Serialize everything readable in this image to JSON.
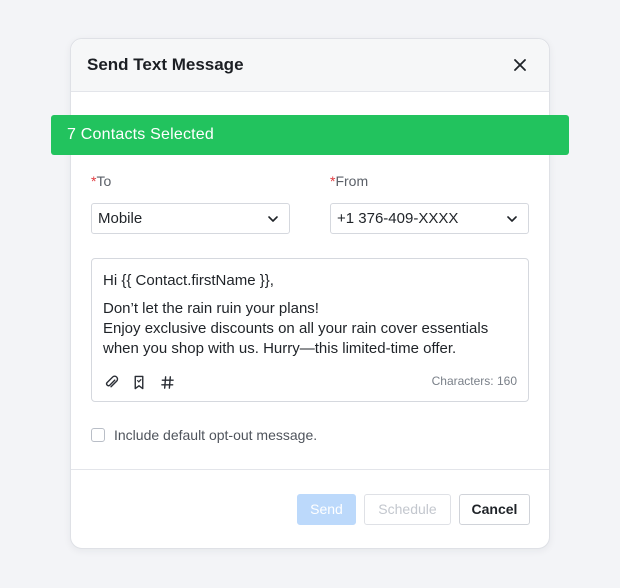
{
  "modal": {
    "title": "Send Text Message",
    "close_icon": "close-icon"
  },
  "banner": {
    "text": "7 Contacts Selected",
    "color": "#22c35e"
  },
  "to": {
    "required_mark": "*",
    "label": "To",
    "value": "Mobile"
  },
  "from": {
    "required_mark": "*",
    "label": "From",
    "value": "+1 376-409-XXXX"
  },
  "message": {
    "greeting": "Hi {{ Contact.firstName }},",
    "line1": "Don’t let the rain ruin your plans!",
    "line2": "Enjoy exclusive discounts on all your rain cover essentials",
    "line3": "when you shop with us. Hurry—this limited-time offer.",
    "char_count": "Characters: 160",
    "tools": [
      "paperclip-icon",
      "bookmark-icon",
      "hash-icon"
    ]
  },
  "optout": {
    "label": "Include default opt-out message.",
    "checked": false
  },
  "buttons": {
    "send": "Send",
    "schedule": "Schedule",
    "cancel": "Cancel"
  },
  "colors": {
    "primary_disabled": "#bcd9fb",
    "required": "#e0393e"
  }
}
